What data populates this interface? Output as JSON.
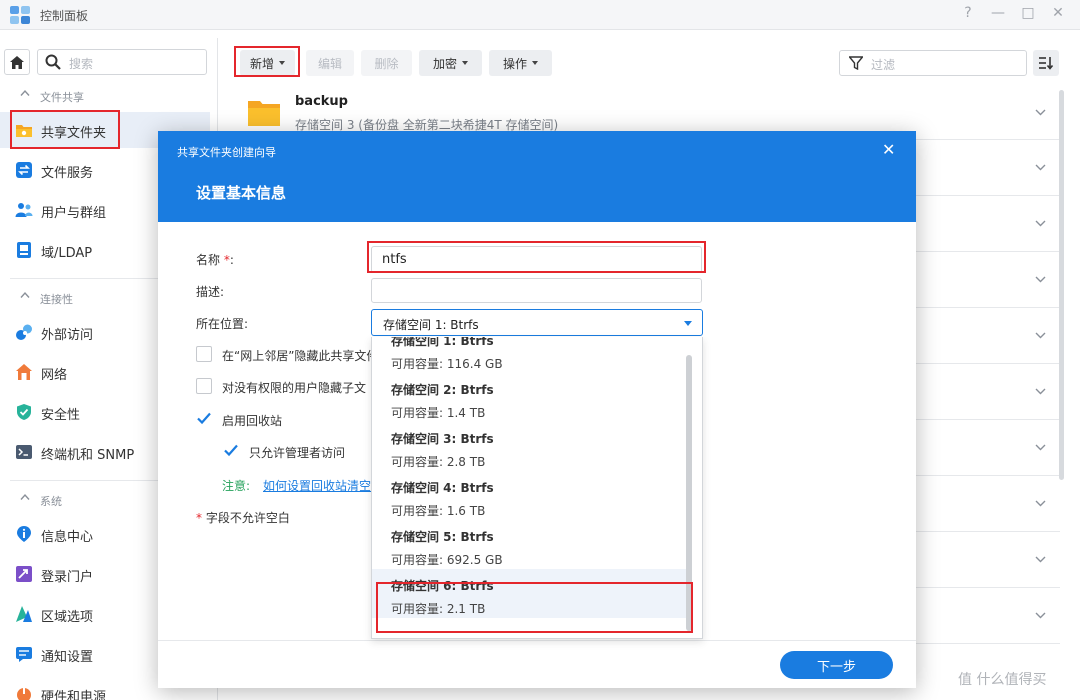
{
  "window": {
    "title": "控制面板",
    "help": "?",
    "minimize": "—",
    "maximize": "□",
    "close": "✕"
  },
  "sidebar": {
    "search_placeholder": "搜索",
    "groups": [
      {
        "label": "文件共享"
      },
      {
        "label": "连接性"
      },
      {
        "label": "系统"
      }
    ],
    "items": [
      {
        "label": "共享文件夹",
        "icon": "shared-folder-icon"
      },
      {
        "label": "文件服务",
        "icon": "file-services-icon"
      },
      {
        "label": "用户与群组",
        "icon": "users-icon"
      },
      {
        "label": "域/LDAP",
        "icon": "domain-icon"
      },
      {
        "label": "外部访问",
        "icon": "external-access-icon"
      },
      {
        "label": "网络",
        "icon": "network-icon"
      },
      {
        "label": "安全性",
        "icon": "security-icon"
      },
      {
        "label": "终端机和 SNMP",
        "icon": "terminal-icon"
      },
      {
        "label": "信息中心",
        "icon": "info-center-icon"
      },
      {
        "label": "登录门户",
        "icon": "login-portal-icon"
      },
      {
        "label": "区域选项",
        "icon": "regional-icon"
      },
      {
        "label": "通知设置",
        "icon": "notification-icon"
      },
      {
        "label": "硬件和电源",
        "icon": "hardware-icon"
      }
    ]
  },
  "toolbar": {
    "create": "新增",
    "edit": "编辑",
    "delete": "删除",
    "encrypt": "加密",
    "action": "操作",
    "filter_placeholder": "过滤"
  },
  "list": {
    "rows": [
      {
        "name": "backup",
        "desc": "存储空间 3 (备份盘 全新第二块希捷4T 存储空间)"
      }
    ]
  },
  "dialog": {
    "subtitle": "共享文件夹创建向导",
    "title": "设置基本信息",
    "close": "✕",
    "name_label": "名称",
    "required_mark": "*",
    "name_colon": ":",
    "name_value": "ntfs",
    "desc_label": "描述:",
    "location_label": "所在位置:",
    "location_value": "存储空间 1:  Btrfs",
    "cb_hide_network": "在“网上邻居”隐藏此共享文件",
    "cb_hide_subfolders": "对没有权限的用户隐藏子文",
    "cb_recycle": "启用回收站",
    "cb_admin_only": "只允许管理者访问",
    "note_label": "注意:",
    "note_link": "如何设置回收站清空",
    "required_note": "字段不允许空白",
    "next_button": "下一步",
    "dropdown": [
      {
        "name": "存储空间 1:  Btrfs",
        "cap": "可用容量:  116.4 GB"
      },
      {
        "name": "存储空间 2:  Btrfs",
        "cap": "可用容量:  1.4 TB"
      },
      {
        "name": "存储空间 3:  Btrfs",
        "cap": "可用容量:  2.8 TB"
      },
      {
        "name": "存储空间 4:  Btrfs",
        "cap": "可用容量:  1.6 TB"
      },
      {
        "name": "存储空间 5:  Btrfs",
        "cap": "可用容量:  692.5 GB"
      },
      {
        "name": "存储空间 6:  Btrfs",
        "cap": "可用容量:  2.1 TB"
      }
    ],
    "selected_index": 5
  },
  "watermark": "值 什么值得买",
  "colors": {
    "accent": "#1a7ce0",
    "highlight": "#e4262c",
    "note": "#26a25c"
  }
}
